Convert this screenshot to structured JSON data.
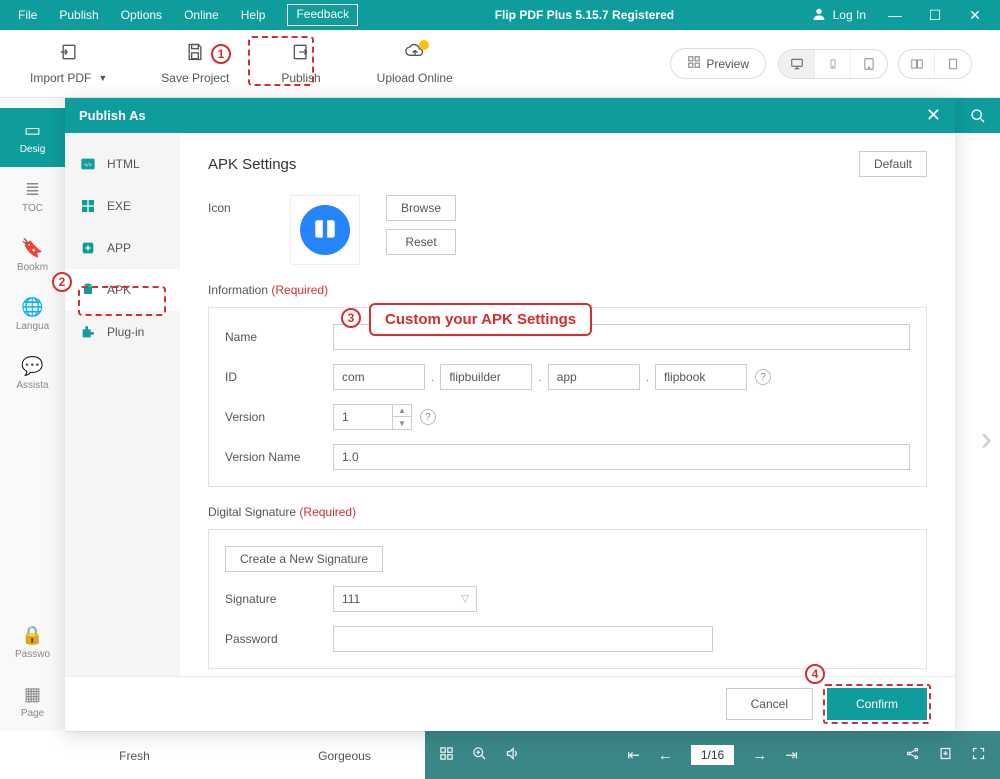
{
  "titlebar": {
    "menu": [
      "File",
      "Publish",
      "Options",
      "Online",
      "Help"
    ],
    "feedback": "Feedback",
    "title": "Flip PDF Plus 5.15.7 Registered",
    "login": "Log In"
  },
  "toolbar": {
    "import_pdf": "Import PDF",
    "save_project": "Save Project",
    "publish": "Publish",
    "upload_online": "Upload Online",
    "preview": "Preview"
  },
  "sidebar": {
    "items": [
      "Desig",
      "TOC",
      "Bookm",
      "Langua",
      "Assista",
      "Passwo",
      "Page"
    ]
  },
  "modal": {
    "title": "Publish As",
    "nav": [
      "HTML",
      "EXE",
      "APP",
      "APK",
      "Plug-in"
    ],
    "content_title": "APK Settings",
    "default_btn": "Default",
    "icon_label": "Icon",
    "browse": "Browse",
    "reset": "Reset",
    "info_header": "Information",
    "required": "(Required)",
    "name_label": "Name",
    "id_label": "ID",
    "id_parts": [
      "com",
      "flipbuilder",
      "app",
      "flipbook"
    ],
    "version_label": "Version",
    "version_value": "1",
    "version_name_label": "Version Name",
    "version_name_value": "1.0",
    "sig_header": "Digital Signature",
    "create_sig": "Create a New Signature",
    "signature_label": "Signature",
    "signature_value": "111",
    "password_label": "Password",
    "cancel": "Cancel",
    "confirm": "Confirm"
  },
  "callouts": {
    "c1": "1",
    "c2": "2",
    "c3": "3",
    "c4": "4",
    "box": "Custom your APK Settings"
  },
  "bottom": {
    "theme1": "Fresh",
    "theme2": "Gorgeous",
    "page": "1/16"
  }
}
